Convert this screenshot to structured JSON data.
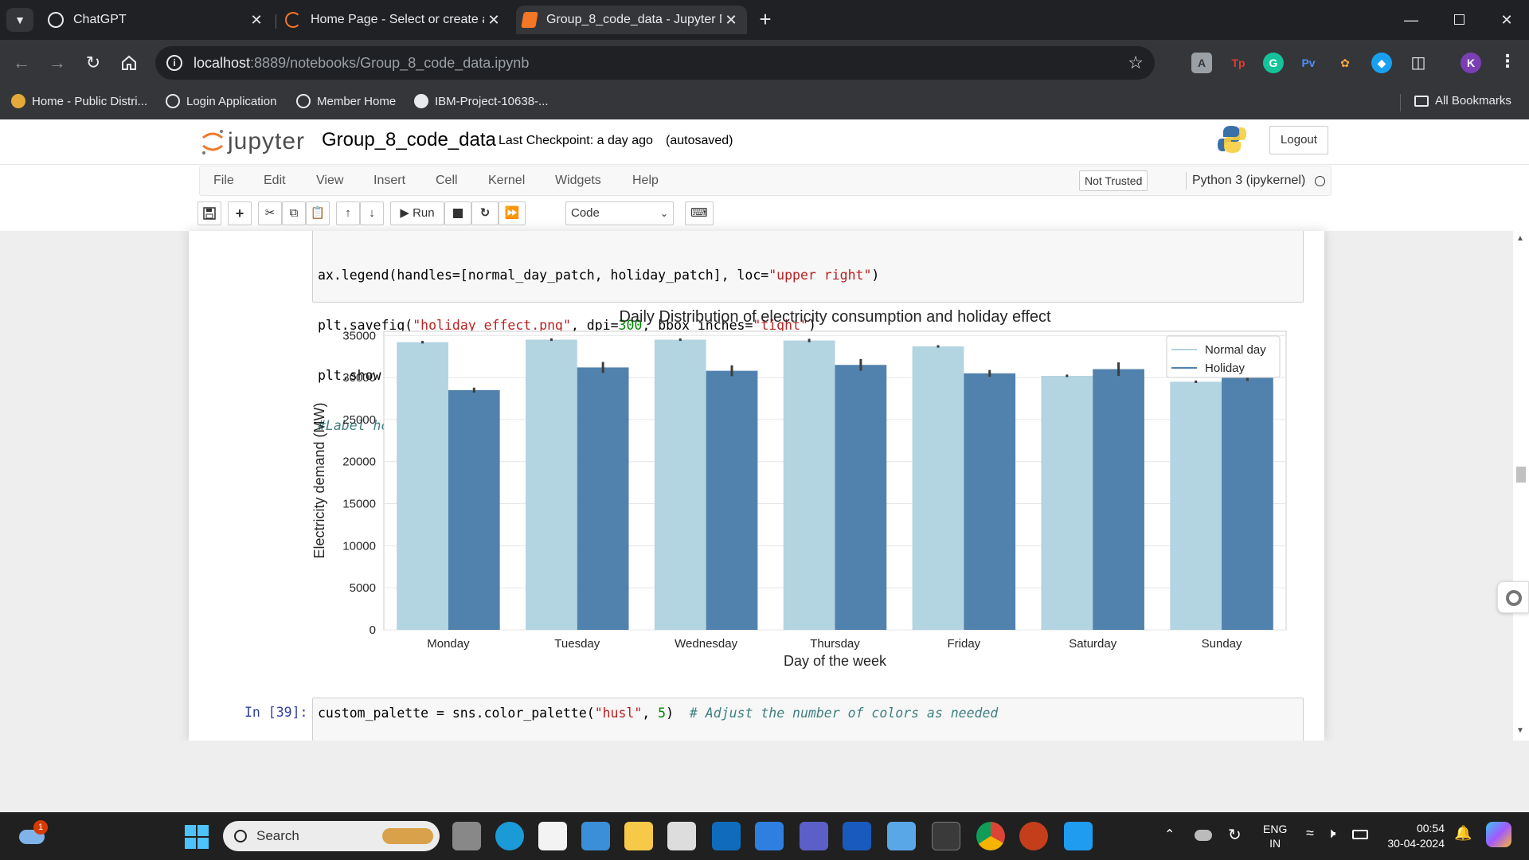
{
  "browser": {
    "tabs": [
      {
        "title": "ChatGPT",
        "active": false
      },
      {
        "title": "Home Page - Select or create a",
        "active": false
      },
      {
        "title": "Group_8_code_data - Jupyter N",
        "active": true
      }
    ],
    "url_host": "localhost",
    "url_path": ":8889/notebooks/Group_8_code_data.ipynb",
    "bookmarks": [
      {
        "label": "Home - Public Distri..."
      },
      {
        "label": "Login Application"
      },
      {
        "label": "Member Home"
      },
      {
        "label": "IBM-Project-10638-..."
      }
    ],
    "all_bookmarks": "All Bookmarks",
    "profile_initial": "K",
    "ext_labels": [
      "Tp",
      "Pv"
    ]
  },
  "jupyter": {
    "logo": "jupyter",
    "notebook_name": "Group_8_code_data",
    "checkpoint": "Last Checkpoint: a day ago",
    "autosave": "(autosaved)",
    "logout": "Logout",
    "menu": [
      "File",
      "Edit",
      "View",
      "Insert",
      "Cell",
      "Kernel",
      "Widgets",
      "Help"
    ],
    "trust": "Not Trusted",
    "kernel": "Python 3 (ipykernel)",
    "run_label": "Run",
    "cell_type": "Code"
  },
  "cells": {
    "prev_code": [
      "ax.legend(handles=[normal_day_patch, holiday_patch], loc=\"upper right\")",
      "plt.savefig(\"holiday_effect.png\", dpi=300, bbox_inches=\"tight\")",
      "plt.show()",
      "#Label holiday or not"
    ],
    "next_prompt": "In [39]:",
    "next_code": "custom_palette = sns.color_palette(\"husl\", 5)  # Adjust the number of colors as needed"
  },
  "chart_data": {
    "type": "bar",
    "title": "Daily Distribution of electricity consumption and holiday effect",
    "xlabel": "Day of the week",
    "ylabel": "Electricity demand (MW)",
    "categories": [
      "Monday",
      "Tuesday",
      "Wednesday",
      "Thursday",
      "Friday",
      "Saturday",
      "Sunday"
    ],
    "series": [
      {
        "name": "Normal day",
        "color": "#b3d4e1",
        "values": [
          34200,
          34500,
          34500,
          34400,
          33700,
          30200,
          29500
        ],
        "err": [
          150,
          150,
          150,
          200,
          150,
          150,
          150
        ]
      },
      {
        "name": "Holiday",
        "color": "#5182ad",
        "values": [
          28500,
          31200,
          30800,
          31500,
          30500,
          31000,
          30100
        ],
        "err": [
          300,
          650,
          650,
          700,
          400,
          800,
          500
        ]
      }
    ],
    "ylim": [
      0,
      35500
    ],
    "yticks": [
      0,
      5000,
      10000,
      15000,
      20000,
      25000,
      30000,
      35000
    ],
    "legend_position": "upper-right",
    "grid": true
  },
  "taskbar": {
    "search": "Search",
    "notif_count": "1",
    "lang1": "ENG",
    "lang2": "IN",
    "time": "00:54",
    "date": "30-04-2024"
  }
}
